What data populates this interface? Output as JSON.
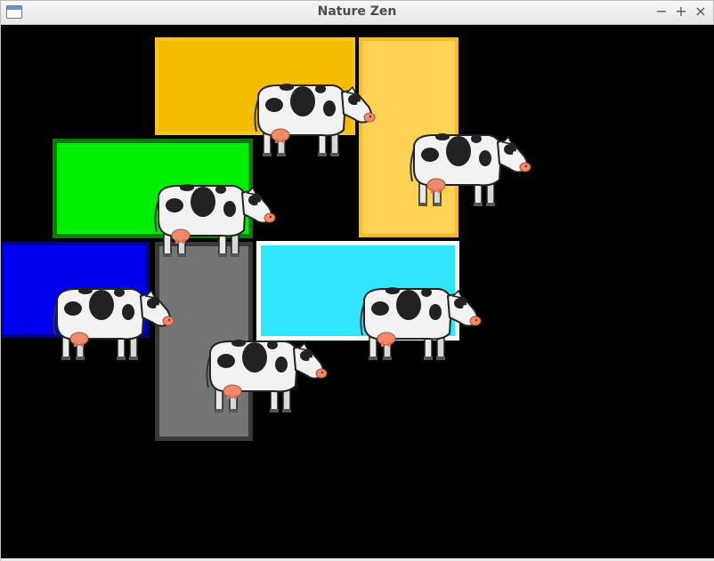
{
  "window": {
    "title": "Nature Zen",
    "minimize_label": "−",
    "maximize_label": "+",
    "close_label": "×",
    "icon": "window-icon"
  },
  "game": {
    "background_color": "#000000",
    "blocks": [
      {
        "name": "yellow-block",
        "fill": "#f5bd00",
        "border": "#f1c42b"
      },
      {
        "name": "light-yellow-block",
        "fill": "#ffd155",
        "border": "#f5ba2d"
      },
      {
        "name": "green-block",
        "fill": "#00ef00",
        "border": "#0c7d0c"
      },
      {
        "name": "blue-block",
        "fill": "#0000f0",
        "border": "#000090"
      },
      {
        "name": "gray-block",
        "fill": "#757575",
        "border": "#393939"
      },
      {
        "name": "cyan-block",
        "fill": "#31e6ff",
        "border": "#ffffff"
      }
    ],
    "cow_count": 6
  }
}
